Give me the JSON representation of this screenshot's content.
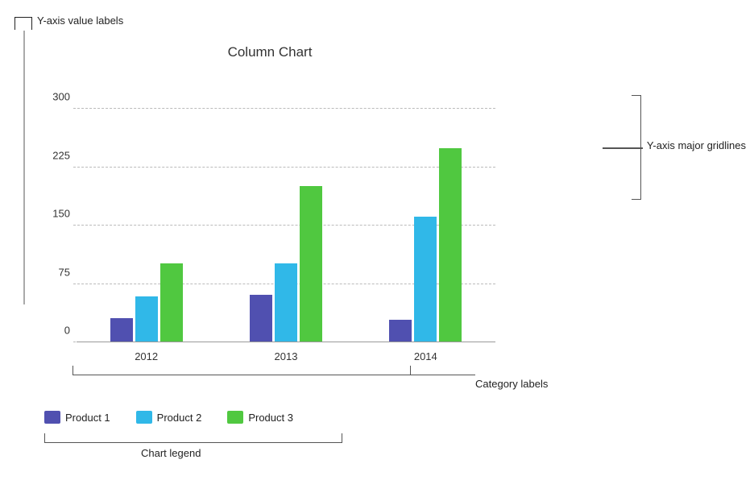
{
  "chart": {
    "title": "Column Chart",
    "yAxis": {
      "labels": [
        "0",
        "75",
        "150",
        "225",
        "300"
      ],
      "max": 300,
      "annotationLabel": "Y-axis value labels"
    },
    "xAxis": {
      "categories": [
        "2012",
        "2013",
        "2014"
      ],
      "annotationLabel": "Category labels"
    },
    "series": [
      {
        "name": "Product 1",
        "color": "#5050b0",
        "data": [
          30,
          60,
          28
        ]
      },
      {
        "name": "Product 2",
        "color": "#30b8e8",
        "data": [
          58,
          100,
          160
        ]
      },
      {
        "name": "Product 3",
        "color": "#50c840",
        "data": [
          100,
          200,
          248
        ]
      }
    ],
    "legend": {
      "annotationLabel": "Chart legend"
    },
    "annotations": {
      "yAxisMajorGridlines": "Y-axis major gridlines"
    }
  }
}
